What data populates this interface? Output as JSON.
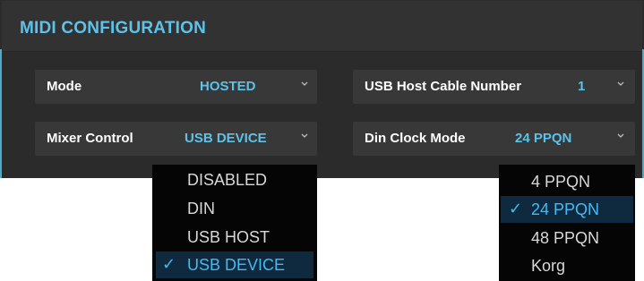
{
  "panel": {
    "title": "MIDI CONFIGURATION"
  },
  "fields": {
    "mode": {
      "label": "Mode",
      "value": "HOSTED"
    },
    "usb_host_cable_number": {
      "label": "USB Host Cable Number",
      "value": "1"
    },
    "mixer_control": {
      "label": "Mixer Control",
      "value": "USB DEVICE"
    },
    "din_clock_mode": {
      "label": "Din Clock Mode",
      "value": "24 PPQN"
    }
  },
  "mixer_control_dropdown": {
    "options": [
      "DISABLED",
      "DIN",
      "USB HOST",
      "USB DEVICE"
    ],
    "selected": "USB DEVICE"
  },
  "din_clock_dropdown": {
    "options": [
      "4 PPQN",
      "24 PPQN",
      "48 PPQN",
      "Korg"
    ],
    "selected": "24 PPQN"
  },
  "check_glyph": "✓",
  "colors": {
    "accent": "#5cc2ea",
    "panel_bg": "#2b2b2b",
    "field_bg": "#383838",
    "dropdown_bg": "#050505",
    "selected_bg": "#0f2a3f"
  },
  "icons": {
    "field_dropdown": "chevron-down-icon",
    "selected_option": "checkmark-icon"
  }
}
